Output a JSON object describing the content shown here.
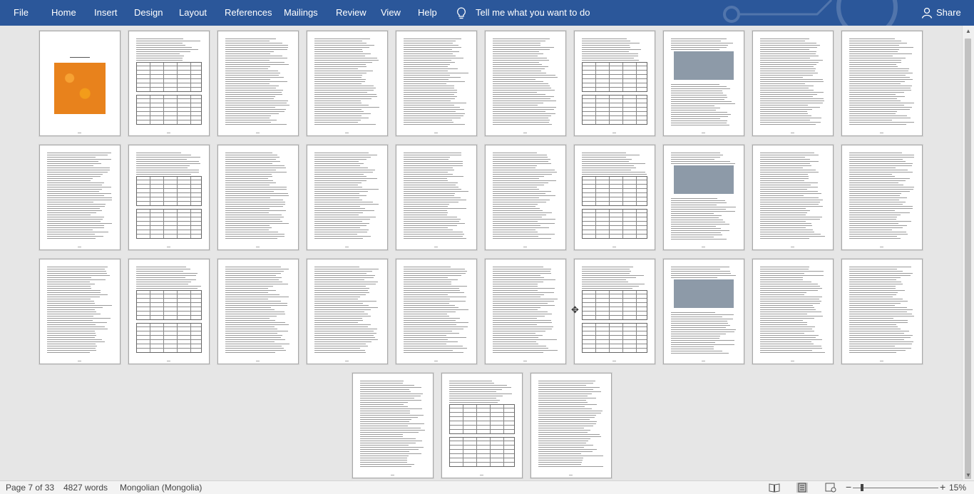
{
  "ribbon": {
    "tabs": [
      "File",
      "Home",
      "Insert",
      "Design",
      "Layout",
      "References",
      "Mailings",
      "Review",
      "View",
      "Help"
    ],
    "tell_me": "Tell me what you want to do",
    "share": "Share",
    "accent": "#2b579a"
  },
  "status": {
    "page": "Page 7 of 33",
    "words": "4827 words",
    "language": "Mongolian (Mongolia)",
    "zoom": "15%"
  },
  "icons": {
    "bulb": "lightbulb-icon",
    "share": "person-icon",
    "views": [
      "read-mode-icon",
      "print-layout-icon",
      "web-layout-icon"
    ]
  }
}
